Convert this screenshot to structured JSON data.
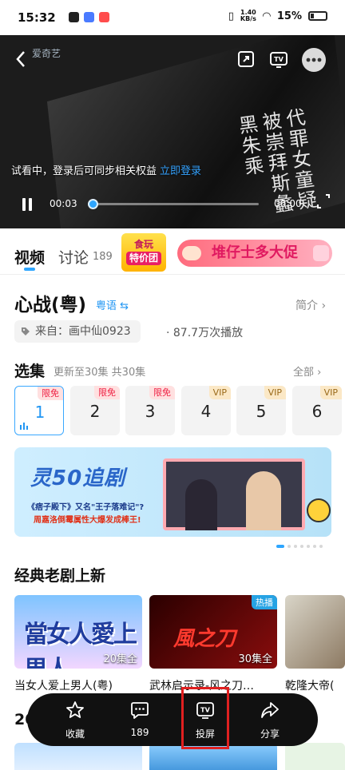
{
  "status_bar": {
    "time": "15:32",
    "net_speed": "1.40",
    "net_unit": "KB/s",
    "battery": "15%"
  },
  "player": {
    "watermark": "爱奇艺",
    "trial_text": "试看中，登录后可同步相关权益",
    "login_link": "立即登录",
    "current_time": "00:03",
    "total_time": "06:00",
    "progress": 0.01,
    "frame_text": "代罪女童疑被崇拜斯蠡黑朱乘"
  },
  "tabs": {
    "video": "视频",
    "discuss": "讨论",
    "discuss_count": "189"
  },
  "ads": {
    "ad1_line1": "食玩",
    "ad1_line2": "特价团",
    "ad2_text": "堆仔士多大促"
  },
  "show": {
    "title": "心战(粤)",
    "language": "粤语 ⇆",
    "intro": "简介 ›",
    "source": "来自：画中仙0923",
    "plays": "· 87.7万次播放"
  },
  "episodes": {
    "heading": "选集",
    "subheading": "更新至30集 共30集",
    "all": "全部 ›",
    "items": [
      {
        "num": "1",
        "badge": "限免"
      },
      {
        "num": "2",
        "badge": "限免"
      },
      {
        "num": "3",
        "badge": "限免"
      },
      {
        "num": "4",
        "badge": "VIP"
      },
      {
        "num": "5",
        "badge": "VIP"
      },
      {
        "num": "6",
        "badge": "VIP"
      }
    ]
  },
  "banner": {
    "logo": "灵50追剧",
    "line1": "《痞子殿下》又名\"王子落难记\"?",
    "line2": "周嘉洛倒霉属性大爆发成棒王!"
  },
  "classics": {
    "heading": "经典老剧上新",
    "cards": [
      {
        "art": "當女人愛上男人",
        "label": "20集全",
        "caption": "当女人爱上男人(粤)",
        "hot": ""
      },
      {
        "art": "風之刀",
        "label": "30集全",
        "caption": "武林启示录-风之刀…",
        "hot": "热播"
      },
      {
        "art": "",
        "label": "",
        "caption": "乾隆大帝(",
        "hot": ""
      }
    ]
  },
  "next_section": {
    "heading": "20"
  },
  "actions": [
    {
      "label": "收藏",
      "icon": "star-icon"
    },
    {
      "label": "189",
      "icon": "comment-icon"
    },
    {
      "label": "投屏",
      "icon": "tv-cast-icon"
    },
    {
      "label": "分享",
      "icon": "share-icon"
    }
  ]
}
